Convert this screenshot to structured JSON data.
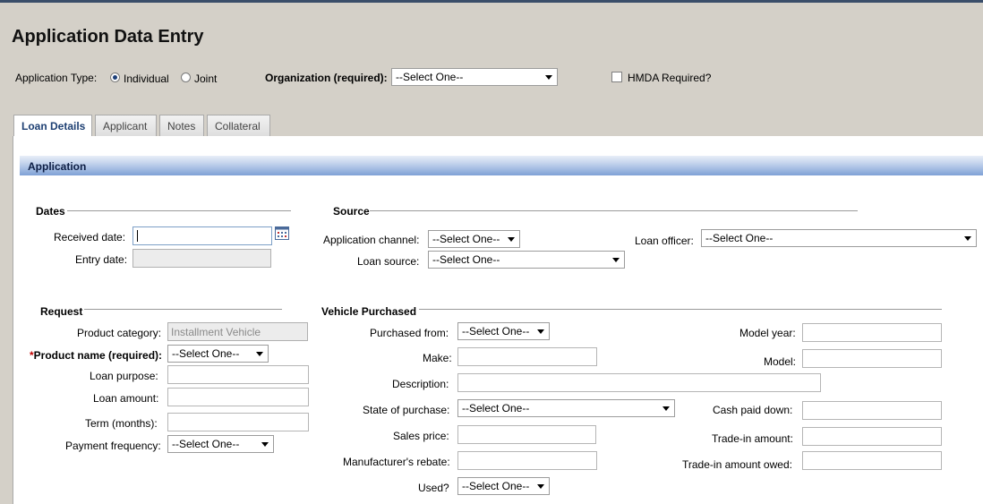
{
  "page_title": "Application Data Entry",
  "header": {
    "app_type_label": "Application Type:",
    "app_type_options": [
      "Individual",
      "Joint"
    ],
    "app_type_selected": "Individual",
    "org_label": "Organization (required):",
    "org_value": "--Select One--",
    "hmda_label": "HMDA Required?"
  },
  "tabs": [
    "Loan Details",
    "Applicant",
    "Notes",
    "Collateral"
  ],
  "section_bar": "Application",
  "dates": {
    "title": "Dates",
    "received_label": "Received date:",
    "entry_label": "Entry date:"
  },
  "source": {
    "title": "Source",
    "channel_label": "Application channel:",
    "channel_value": "--Select One--",
    "loan_source_label": "Loan source:",
    "loan_source_value": "--Select One--",
    "officer_label": "Loan officer:",
    "officer_value": "--Select One--"
  },
  "request": {
    "title": "Request",
    "product_category_label": "Product category:",
    "product_category_value": "Installment Vehicle",
    "product_name_star": "*",
    "product_name_label": "Product name (required):",
    "product_name_value": "--Select One--",
    "loan_purpose_label": "Loan purpose:",
    "loan_amount_label": "Loan amount:",
    "term_label": "Term (months):",
    "payment_freq_label": "Payment frequency:",
    "payment_freq_value": "--Select One--"
  },
  "vehicle": {
    "title": "Vehicle Purchased",
    "purchased_from_label": "Purchased from:",
    "purchased_from_value": "--Select One--",
    "make_label": "Make:",
    "description_label": "Description:",
    "state_label": "State of purchase:",
    "state_value": "--Select One--",
    "sales_price_label": "Sales price:",
    "rebate_label": "Manufacturer's rebate:",
    "used_label": "Used?",
    "used_value": "--Select One--",
    "model_year_label": "Model year:",
    "model_label": "Model:",
    "cash_down_label": "Cash paid down:",
    "tradein_label": "Trade-in amount:",
    "tradein_owed_label": "Trade-in amount owed:"
  }
}
